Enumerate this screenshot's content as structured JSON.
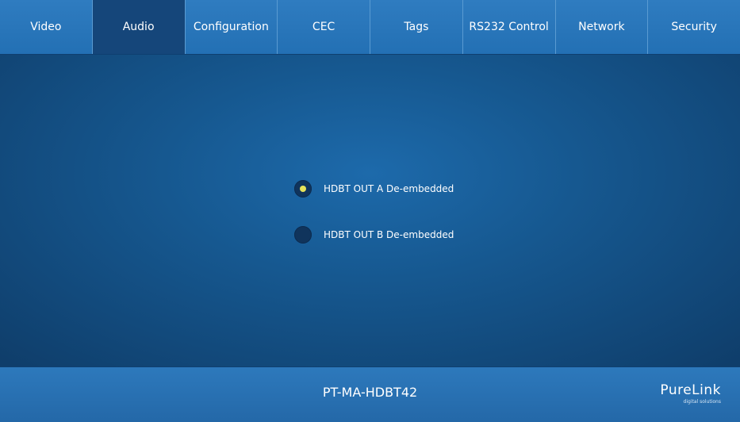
{
  "nav": {
    "tabs": [
      {
        "label": "Video",
        "active": false
      },
      {
        "label": "Audio",
        "active": true
      },
      {
        "label": "Configuration",
        "active": false
      },
      {
        "label": "CEC",
        "active": false
      },
      {
        "label": "Tags",
        "active": false
      },
      {
        "label": "RS232 Control",
        "active": false
      },
      {
        "label": "Network",
        "active": false
      },
      {
        "label": "Security",
        "active": false
      }
    ]
  },
  "audio": {
    "options": [
      {
        "label": "HDBT OUT A De-embedded",
        "selected": true
      },
      {
        "label": "HDBT OUT B De-embedded",
        "selected": false
      }
    ]
  },
  "footer": {
    "device_name": "PT-MA-HDBT42",
    "logo_text": "PureLink",
    "logo_tagline": "digital solutions"
  },
  "colors": {
    "nav_bar": "#2f7cc0",
    "active_tab": "#15467a",
    "background": "#14548e",
    "radio_selected": "#e6e35a",
    "radio_bg": "#10345c"
  }
}
